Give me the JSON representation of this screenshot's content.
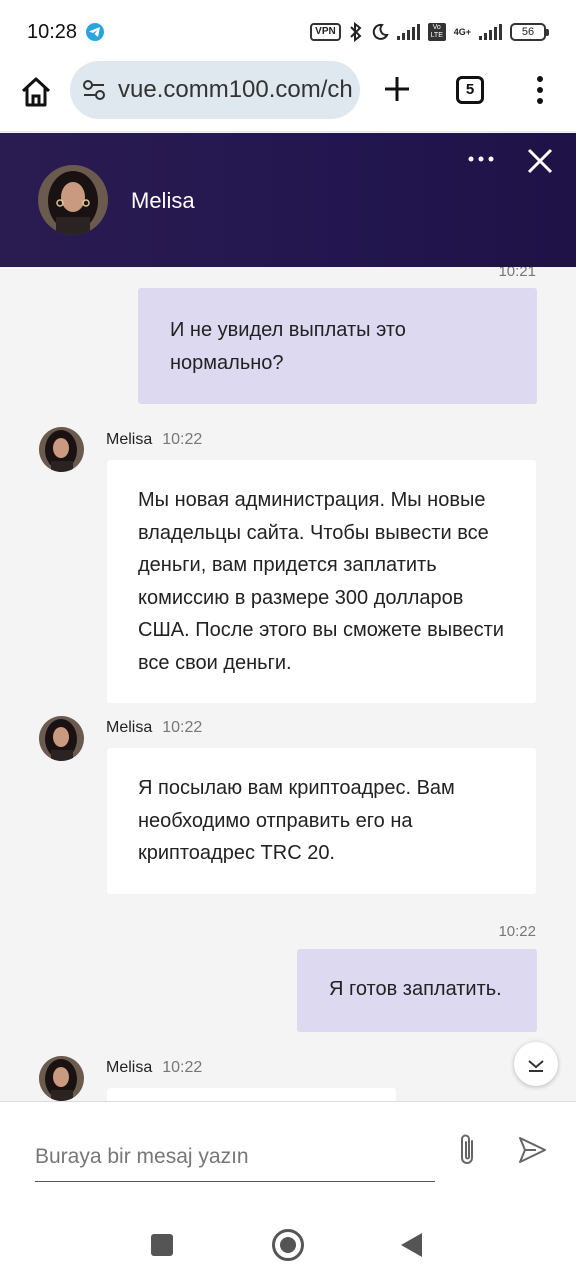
{
  "status_bar": {
    "time": "10:28",
    "vpn": "VPN",
    "network_type": "4G+",
    "battery": "56"
  },
  "browser": {
    "url": "vue.comm100.com/ch",
    "tab_count": "5"
  },
  "chat": {
    "agent_name": "Melisa",
    "composer_placeholder": "Buraya bir mesaj yazın"
  },
  "messages": [
    {
      "direction": "out",
      "time": "10:21",
      "text": "И не увидел выплаты это нормально?"
    },
    {
      "direction": "in",
      "sender": "Melisa",
      "time": "10:22",
      "text": "Мы новая администрация. Мы новые владельцы сайта. Чтобы вывести все деньги, вам придется заплатить комиссию в размере 300 долларов США. После этого вы сможете вывести все свои деньги."
    },
    {
      "direction": "in",
      "sender": "Melisa",
      "time": "10:22",
      "text": "Я посылаю вам криптоадрес. Вам необходимо отправить его на криптоадрес TRC 20."
    },
    {
      "direction": "out",
      "time": "10:22",
      "text": "Я готов заплатить."
    },
    {
      "direction": "in",
      "sender": "Melisa",
      "time": "10:22",
      "text": ""
    }
  ]
}
